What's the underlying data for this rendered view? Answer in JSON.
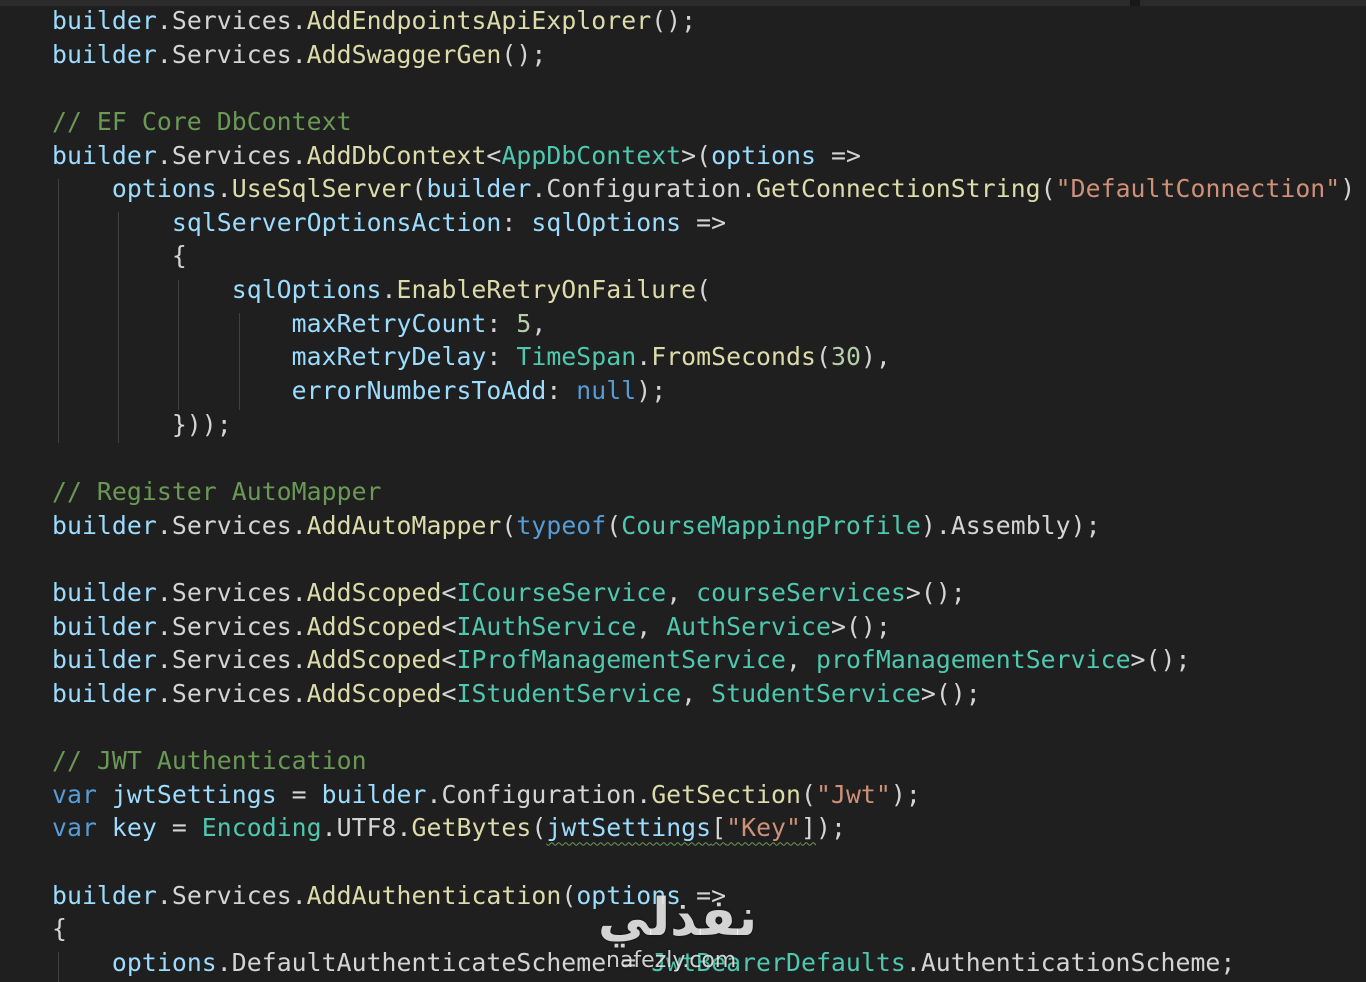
{
  "colors": {
    "background": "#1f1f1f",
    "default_text": "#d4d4d4",
    "variable": "#9cdcfe",
    "method": "#dcdcaa",
    "type": "#4ec9b0",
    "keyword": "#569cd6",
    "string": "#ce9178",
    "number": "#b5cea8",
    "comment": "#6a9955",
    "punctuation": "#d4d4d4"
  },
  "editor": {
    "lines": [
      [
        [
          "builder",
          "variable"
        ],
        [
          ".",
          "punctuation"
        ],
        [
          "Services",
          "default"
        ],
        [
          ".",
          "punctuation"
        ],
        [
          "AddEndpointsApiExplorer",
          "method"
        ],
        [
          "();",
          "punctuation"
        ]
      ],
      [
        [
          "builder",
          "variable"
        ],
        [
          ".",
          "punctuation"
        ],
        [
          "Services",
          "default"
        ],
        [
          ".",
          "punctuation"
        ],
        [
          "AddSwaggerGen",
          "method"
        ],
        [
          "();",
          "punctuation"
        ]
      ],
      [],
      [
        [
          "// EF Core DbContext",
          "comment"
        ]
      ],
      [
        [
          "builder",
          "variable"
        ],
        [
          ".",
          "punctuation"
        ],
        [
          "Services",
          "default"
        ],
        [
          ".",
          "punctuation"
        ],
        [
          "AddDbContext",
          "method"
        ],
        [
          "<",
          "punctuation"
        ],
        [
          "AppDbContext",
          "type"
        ],
        [
          ">(",
          "punctuation"
        ],
        [
          "options",
          "variable"
        ],
        [
          " =>",
          "punctuation"
        ]
      ],
      [
        [
          "    ",
          "punctuation"
        ],
        [
          "options",
          "variable"
        ],
        [
          ".",
          "punctuation"
        ],
        [
          "UseSqlServer",
          "method"
        ],
        [
          "(",
          "punctuation"
        ],
        [
          "builder",
          "variable"
        ],
        [
          ".",
          "punctuation"
        ],
        [
          "Configuration",
          "default"
        ],
        [
          ".",
          "punctuation"
        ],
        [
          "GetConnectionString",
          "method"
        ],
        [
          "(",
          "punctuation"
        ],
        [
          "\"DefaultConnection\"",
          "string"
        ],
        [
          ")",
          "punctuation"
        ]
      ],
      [
        [
          "        ",
          "punctuation"
        ],
        [
          "sqlServerOptionsAction",
          "variable"
        ],
        [
          ": ",
          "punctuation"
        ],
        [
          "sqlOptions",
          "variable"
        ],
        [
          " =>",
          "punctuation"
        ]
      ],
      [
        [
          "        {",
          "punctuation"
        ]
      ],
      [
        [
          "            ",
          "punctuation"
        ],
        [
          "sqlOptions",
          "variable"
        ],
        [
          ".",
          "punctuation"
        ],
        [
          "EnableRetryOnFailure",
          "method"
        ],
        [
          "(",
          "punctuation"
        ]
      ],
      [
        [
          "                ",
          "punctuation"
        ],
        [
          "maxRetryCount",
          "variable"
        ],
        [
          ": ",
          "punctuation"
        ],
        [
          "5",
          "number"
        ],
        [
          ",",
          "punctuation"
        ]
      ],
      [
        [
          "                ",
          "punctuation"
        ],
        [
          "maxRetryDelay",
          "variable"
        ],
        [
          ": ",
          "punctuation"
        ],
        [
          "TimeSpan",
          "type"
        ],
        [
          ".",
          "punctuation"
        ],
        [
          "FromSeconds",
          "method"
        ],
        [
          "(",
          "punctuation"
        ],
        [
          "30",
          "number"
        ],
        [
          "),",
          "punctuation"
        ]
      ],
      [
        [
          "                ",
          "punctuation"
        ],
        [
          "errorNumbersToAdd",
          "variable"
        ],
        [
          ": ",
          "punctuation"
        ],
        [
          "null",
          "keyword"
        ],
        [
          ");",
          "punctuation"
        ]
      ],
      [
        [
          "        }));",
          "punctuation"
        ]
      ],
      [],
      [
        [
          "// Register AutoMapper",
          "comment"
        ]
      ],
      [
        [
          "builder",
          "variable"
        ],
        [
          ".",
          "punctuation"
        ],
        [
          "Services",
          "default"
        ],
        [
          ".",
          "punctuation"
        ],
        [
          "AddAutoMapper",
          "method"
        ],
        [
          "(",
          "punctuation"
        ],
        [
          "typeof",
          "keyword"
        ],
        [
          "(",
          "punctuation"
        ],
        [
          "CourseMappingProfile",
          "type"
        ],
        [
          ").",
          "punctuation"
        ],
        [
          "Assembly",
          "default"
        ],
        [
          ");",
          "punctuation"
        ]
      ],
      [],
      [
        [
          "builder",
          "variable"
        ],
        [
          ".",
          "punctuation"
        ],
        [
          "Services",
          "default"
        ],
        [
          ".",
          "punctuation"
        ],
        [
          "AddScoped",
          "method"
        ],
        [
          "<",
          "punctuation"
        ],
        [
          "ICourseService",
          "type"
        ],
        [
          ", ",
          "punctuation"
        ],
        [
          "courseServices",
          "type"
        ],
        [
          ">();",
          "punctuation"
        ]
      ],
      [
        [
          "builder",
          "variable"
        ],
        [
          ".",
          "punctuation"
        ],
        [
          "Services",
          "default"
        ],
        [
          ".",
          "punctuation"
        ],
        [
          "AddScoped",
          "method"
        ],
        [
          "<",
          "punctuation"
        ],
        [
          "IAuthService",
          "type"
        ],
        [
          ", ",
          "punctuation"
        ],
        [
          "AuthService",
          "type"
        ],
        [
          ">();",
          "punctuation"
        ]
      ],
      [
        [
          "builder",
          "variable"
        ],
        [
          ".",
          "punctuation"
        ],
        [
          "Services",
          "default"
        ],
        [
          ".",
          "punctuation"
        ],
        [
          "AddScoped",
          "method"
        ],
        [
          "<",
          "punctuation"
        ],
        [
          "IProfManagementService",
          "type"
        ],
        [
          ", ",
          "punctuation"
        ],
        [
          "profManagementService",
          "type"
        ],
        [
          ">();",
          "punctuation"
        ]
      ],
      [
        [
          "builder",
          "variable"
        ],
        [
          ".",
          "punctuation"
        ],
        [
          "Services",
          "default"
        ],
        [
          ".",
          "punctuation"
        ],
        [
          "AddScoped",
          "method"
        ],
        [
          "<",
          "punctuation"
        ],
        [
          "IStudentService",
          "type"
        ],
        [
          ", ",
          "punctuation"
        ],
        [
          "StudentService",
          "type"
        ],
        [
          ">();",
          "punctuation"
        ]
      ],
      [],
      [
        [
          "// JWT Authentication",
          "comment"
        ]
      ],
      [
        [
          "var",
          "keyword"
        ],
        [
          " ",
          "punctuation"
        ],
        [
          "jwtSettings",
          "variable"
        ],
        [
          " = ",
          "punctuation"
        ],
        [
          "builder",
          "variable"
        ],
        [
          ".",
          "punctuation"
        ],
        [
          "Configuration",
          "default"
        ],
        [
          ".",
          "punctuation"
        ],
        [
          "GetSection",
          "method"
        ],
        [
          "(",
          "punctuation"
        ],
        [
          "\"Jwt\"",
          "string"
        ],
        [
          ");",
          "punctuation"
        ]
      ],
      [
        [
          "var",
          "keyword"
        ],
        [
          " ",
          "punctuation"
        ],
        [
          "key",
          "variable"
        ],
        [
          " = ",
          "punctuation"
        ],
        [
          "Encoding",
          "type"
        ],
        [
          ".",
          "punctuation"
        ],
        [
          "UTF8",
          "default"
        ],
        [
          ".",
          "punctuation"
        ],
        [
          "GetBytes",
          "method"
        ],
        [
          "(",
          "punctuation"
        ],
        [
          "jwtSettings[\"Key\"]",
          "squiggle"
        ],
        [
          ");",
          "punctuation"
        ]
      ],
      [],
      [
        [
          "builder",
          "variable"
        ],
        [
          ".",
          "punctuation"
        ],
        [
          "Services",
          "default"
        ],
        [
          ".",
          "punctuation"
        ],
        [
          "AddAuthentication",
          "method"
        ],
        [
          "(",
          "punctuation"
        ],
        [
          "options",
          "variable"
        ],
        [
          " =>",
          "punctuation"
        ]
      ],
      [
        [
          "{",
          "punctuation"
        ]
      ],
      [
        [
          "    ",
          "punctuation"
        ],
        [
          "options",
          "variable"
        ],
        [
          ".",
          "punctuation"
        ],
        [
          "DefaultAuthenticateScheme",
          "default"
        ],
        [
          " = ",
          "punctuation"
        ],
        [
          "JwtBearerDefaults",
          "type"
        ],
        [
          ".",
          "punctuation"
        ],
        [
          "AuthenticationScheme",
          "default"
        ],
        [
          ";",
          "punctuation"
        ]
      ]
    ]
  },
  "watermark": {
    "arabic": "نفذلي",
    "latin": "nafezly.com"
  }
}
